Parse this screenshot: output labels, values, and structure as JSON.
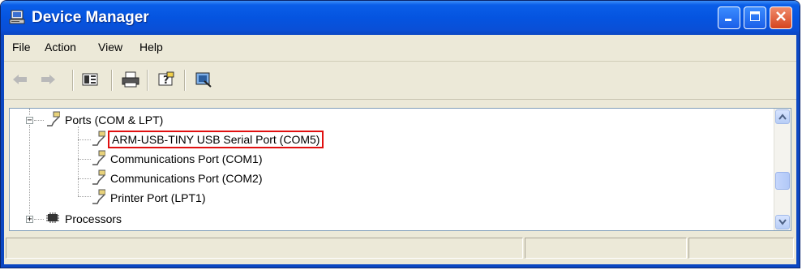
{
  "window": {
    "title": "Device Manager",
    "controls": {
      "minimize": "minimize",
      "maximize": "maximize",
      "close": "close"
    }
  },
  "menu": [
    {
      "label": "File"
    },
    {
      "label": "Action"
    },
    {
      "label": "View"
    },
    {
      "label": "Help"
    }
  ],
  "toolbar": {
    "buttons": [
      "back-icon",
      "forward-icon",
      "show-hide-console-tree-icon",
      "print-icon",
      "help-icon",
      "scan-hardware-icon"
    ]
  },
  "tree": {
    "ports_category": "Ports (COM & LPT)",
    "ports_children": [
      {
        "label": "ARM-USB-TINY USB Serial Port (COM5)",
        "highlighted": true
      },
      {
        "label": "Communications Port (COM1)"
      },
      {
        "label": "Communications Port (COM2)"
      },
      {
        "label": "Printer Port (LPT1)"
      }
    ],
    "processors_category": "Processors"
  },
  "colors": {
    "titlebar": "#0554e0",
    "highlight_box": "#e01010",
    "close_button": "#d6441e"
  }
}
